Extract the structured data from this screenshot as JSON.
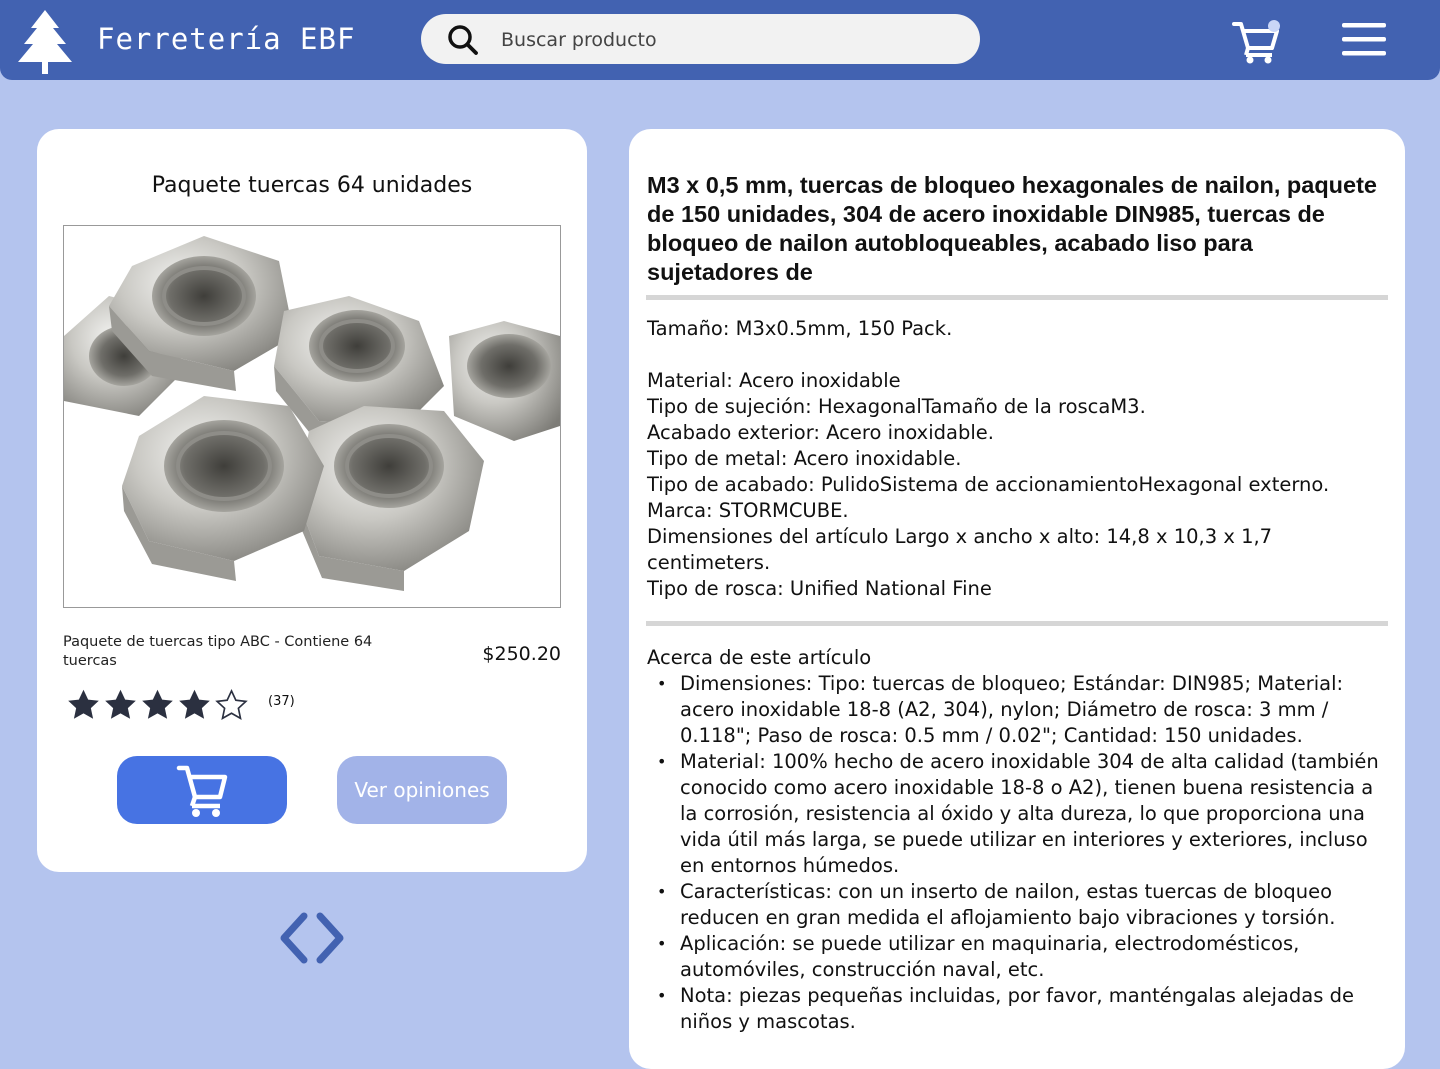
{
  "header": {
    "brand": "Ferretería EBF",
    "search_placeholder": "Buscar producto",
    "colors": {
      "bar": "#4262b1",
      "page_bg": "#b4c4ee"
    },
    "icons": [
      "tree-logo-icon",
      "search-icon",
      "cart-icon",
      "notification-dot-icon",
      "hamburger-menu-icon"
    ]
  },
  "product_card": {
    "title": "Paquete tuercas 64 unidades",
    "image_alt": "hex-nuts-image",
    "description": "Paquete de tuercas tipo ABC - Contiene 64 tuercas",
    "price": "$250.20",
    "rating": 4,
    "rating_max": 5,
    "reviews_count": "(37)",
    "reviews_button": "Ver opiniones",
    "colors": {
      "cart_button": "#4773e3",
      "reviews_button": "#a2b3e8",
      "star": "#2b3040"
    }
  },
  "pager": {
    "icons": [
      "chevron-left-icon",
      "chevron-right-icon"
    ],
    "color": "#4262b1"
  },
  "detail": {
    "title": "M3 x 0,5 mm, tuercas de bloqueo hexagonales de nailon, paquete de 150 unidades, 304 de acero inoxidable DIN985, tuercas de bloqueo de nailon autobloqueables, acabado liso para sujetadores de",
    "size_line": "Tamaño: M3x0.5mm, 150 Pack.",
    "specs": [
      "Material: Acero inoxidable",
      "Tipo de sujeción: HexagonalTamaño de la roscaM3.",
      "Acabado exterior: Acero inoxidable.",
      "Tipo de metal: Acero inoxidable.",
      "Tipo de acabado: PulidoSistema de accionamientoHexagonal externo.",
      "Marca: STORMCUBE.",
      "Dimensiones del artículo Largo x ancho x alto: 14,8 x 10,3 x 1,7 centimeters.",
      "Tipo de rosca: Unified National Fine"
    ],
    "about_title": "Acerca de este artículo",
    "about_items": [
      "Dimensiones: Tipo: tuercas de bloqueo; Estándar: DIN985; Material: acero inoxidable 18-8 (A2, 304), nylon; Diámetro de rosca: 3 mm / 0.118\"; Paso de rosca: 0.5 mm / 0.02\"; Cantidad: 150 unidades.",
      "Material: 100% hecho de acero inoxidable 304 de alta calidad (también conocido como acero inoxidable 18-8 o A2), tienen buena resistencia a la corrosión, resistencia al óxido y alta dureza, lo que proporciona una vida útil más larga, se puede utilizar en interiores y exteriores, incluso en entornos húmedos.",
      "Características: con un inserto de nailon, estas tuercas de bloqueo reducen en gran medida el aflojamiento bajo vibraciones y torsión.",
      "Aplicación: se puede utilizar en maquinaria, electrodomésticos, automóviles, construcción naval, etc.",
      "Nota: piezas pequeñas incluidas, por favor, manténgalas alejadas de niños y mascotas."
    ]
  }
}
